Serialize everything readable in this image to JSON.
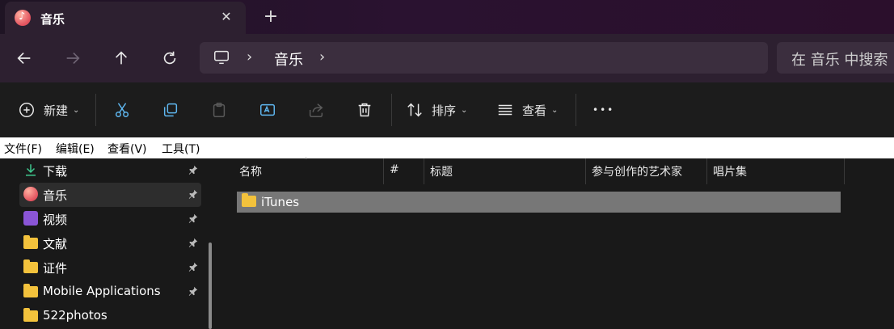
{
  "window": {
    "tab_title": "音乐",
    "tab_close": "✕",
    "new_tab": "+"
  },
  "nav": {
    "breadcrumb": [
      "音乐"
    ],
    "breadcrumb_sep": "›",
    "search_placeholder": "在 音乐 中搜索"
  },
  "toolbar": {
    "new_label": "新建",
    "sort_label": "排序",
    "view_label": "查看",
    "chevron": "⌄",
    "more": "•••"
  },
  "menubar": {
    "items": [
      "文件(F)",
      "编辑(E)",
      "查看(V)",
      "工具(T)"
    ]
  },
  "sidebar": {
    "items": [
      {
        "label": "下载",
        "icon": "download-icon",
        "pinned": true
      },
      {
        "label": "音乐",
        "icon": "music-icon",
        "pinned": true,
        "selected": true
      },
      {
        "label": "视频",
        "icon": "video-icon",
        "pinned": true
      },
      {
        "label": "文献",
        "icon": "folder-icon",
        "pinned": true
      },
      {
        "label": "证件",
        "icon": "folder-icon",
        "pinned": true
      },
      {
        "label": "Mobile Applications",
        "icon": "folder-icon",
        "pinned": true
      },
      {
        "label": "522photos",
        "icon": "folder-icon",
        "pinned": false
      }
    ]
  },
  "main": {
    "columns": [
      "名称",
      "#",
      "标题",
      "参与创作的艺术家",
      "唱片集"
    ],
    "sort_indicator": "˄",
    "rows": [
      {
        "name": "iTunes",
        "icon": "folder-icon",
        "selected": true
      }
    ]
  },
  "colors": {
    "titlebar": "#2a1230",
    "navbar": "#2d2030",
    "folder": "#f3c23c",
    "selected_row": "#777777"
  }
}
